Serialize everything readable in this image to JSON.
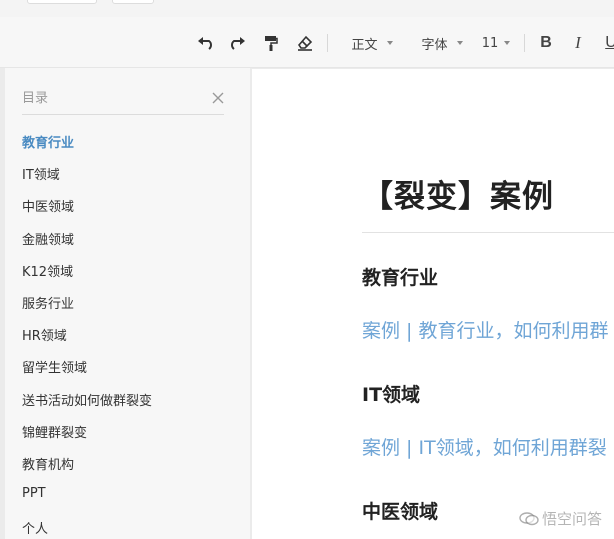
{
  "toolbar": {
    "style_select": "正文",
    "font_select": "字体",
    "size_select": "11",
    "bold_label": "B",
    "italic_label": "I",
    "underline_label": "U"
  },
  "sidebar": {
    "title": "目录",
    "items": [
      {
        "label": "教育行业",
        "active": true
      },
      {
        "label": "IT领域"
      },
      {
        "label": "中医领域"
      },
      {
        "label": "金融领域"
      },
      {
        "label": "K12领域"
      },
      {
        "label": "服务行业"
      },
      {
        "label": "HR领域"
      },
      {
        "label": "留学生领域"
      },
      {
        "label": "送书活动如何做群裂变"
      },
      {
        "label": "锦鲤群裂变"
      },
      {
        "label": "教育机构"
      },
      {
        "label": "PPT"
      },
      {
        "label": "个人"
      }
    ]
  },
  "document": {
    "title": "【裂变】案例",
    "sections": [
      {
        "heading": "教育行业",
        "link": "案例 | 教育行业，如何利用群"
      },
      {
        "heading": "IT领域",
        "link": "案例 | IT领域，如何利用群裂"
      },
      {
        "heading": "中医领域"
      }
    ]
  },
  "watermark": "悟空问答",
  "colors": {
    "accent": "#4a8bc2",
    "link": "#6fa5d6",
    "sidebar_bg": "#f7f7f7",
    "page_bg": "#ebebeb"
  }
}
